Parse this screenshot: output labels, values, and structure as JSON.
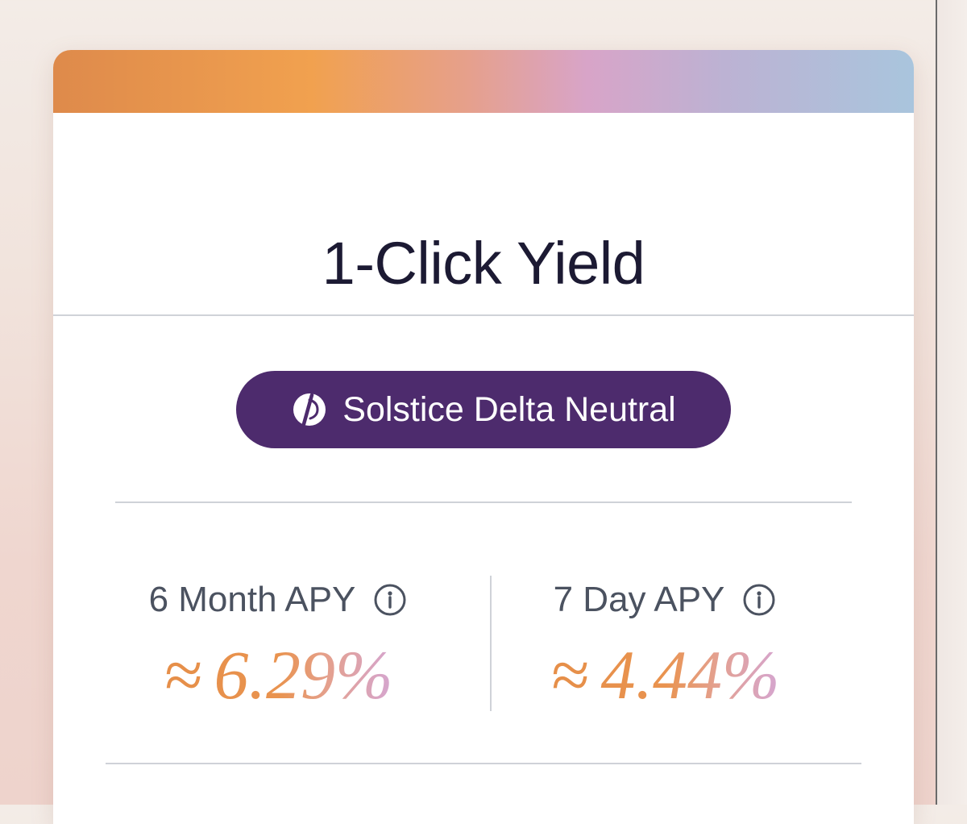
{
  "card": {
    "title": "1-Click Yield"
  },
  "strategy": {
    "label": "Solstice Delta Neutral",
    "icon": "solstice-logo-icon"
  },
  "stats": [
    {
      "label": "6 Month APY",
      "approx": "≈",
      "value": "6.29%",
      "info_icon": "info-icon"
    },
    {
      "label": "7 Day APY",
      "approx": "≈",
      "value": "4.44%",
      "info_icon": "info-icon"
    }
  ],
  "colors": {
    "badge_background": "#4d2b6d",
    "title_text": "#1c1a33",
    "label_text": "#4b5260",
    "gradient_orange": "#e48c45",
    "gradient_pink": "#d7a5c9",
    "gradient_blue": "#a9c2dd"
  }
}
